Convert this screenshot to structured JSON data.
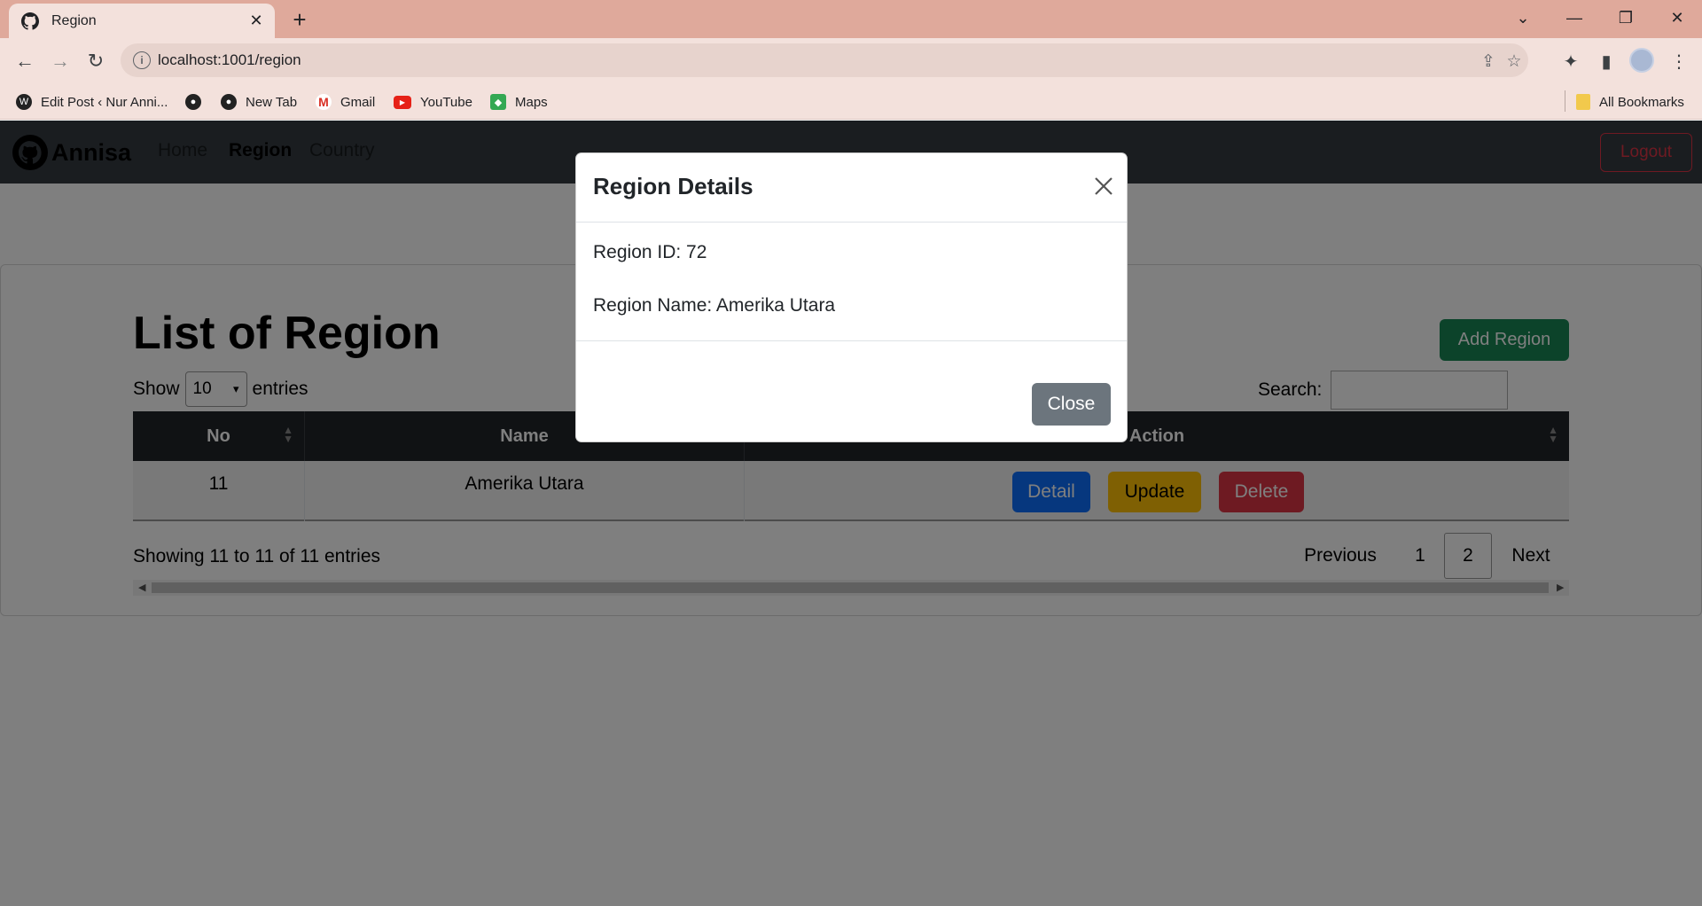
{
  "browser": {
    "tab_title": "Region",
    "tab_close": "✕",
    "new_tab": "+",
    "url": "localhost:1001/region",
    "bookmarks": [
      {
        "label": "Edit Post ‹ Nur Anni...",
        "icon": "wordpress-icon"
      },
      {
        "label": "",
        "icon": "globe-icon"
      },
      {
        "label": "New Tab",
        "icon": "globe-icon"
      },
      {
        "label": "Gmail",
        "icon": "gmail-icon"
      },
      {
        "label": "YouTube",
        "icon": "youtube-icon"
      },
      {
        "label": "Maps",
        "icon": "maps-icon"
      }
    ],
    "all_bookmarks": "All Bookmarks"
  },
  "navbar": {
    "brand": "Annisa",
    "links": [
      "Home",
      "Region",
      "Country"
    ],
    "active_link": "Region",
    "logout": "Logout"
  },
  "main": {
    "title": "List of Region",
    "add_button": "Add Region",
    "show_label": "Show",
    "entries_label": "entries",
    "page_length": "10",
    "search_label": "Search:",
    "search_value": "",
    "columns": [
      "No",
      "Name",
      "Action"
    ],
    "rows": [
      {
        "no": "11",
        "name": "Amerika Utara"
      }
    ],
    "actions": [
      "Detail",
      "Update",
      "Delete"
    ],
    "info": "Showing 11 to 11 of 11 entries",
    "pagination": {
      "previous": "Previous",
      "pages": [
        "1",
        "2"
      ],
      "current": "2",
      "next": "Next"
    }
  },
  "modal": {
    "title": "Region Details",
    "region_id": "Region ID: 72",
    "region_name": "Region Name: Amerika Utara",
    "close_button": "Close"
  },
  "colors": {
    "navbar": "#343a40",
    "success": "#198754",
    "primary": "#0d6efd",
    "warning": "#ffc107",
    "danger": "#dc3545",
    "secondary": "#6c757d",
    "table_head": "#212529",
    "tab_strip": "#dfa99b"
  }
}
